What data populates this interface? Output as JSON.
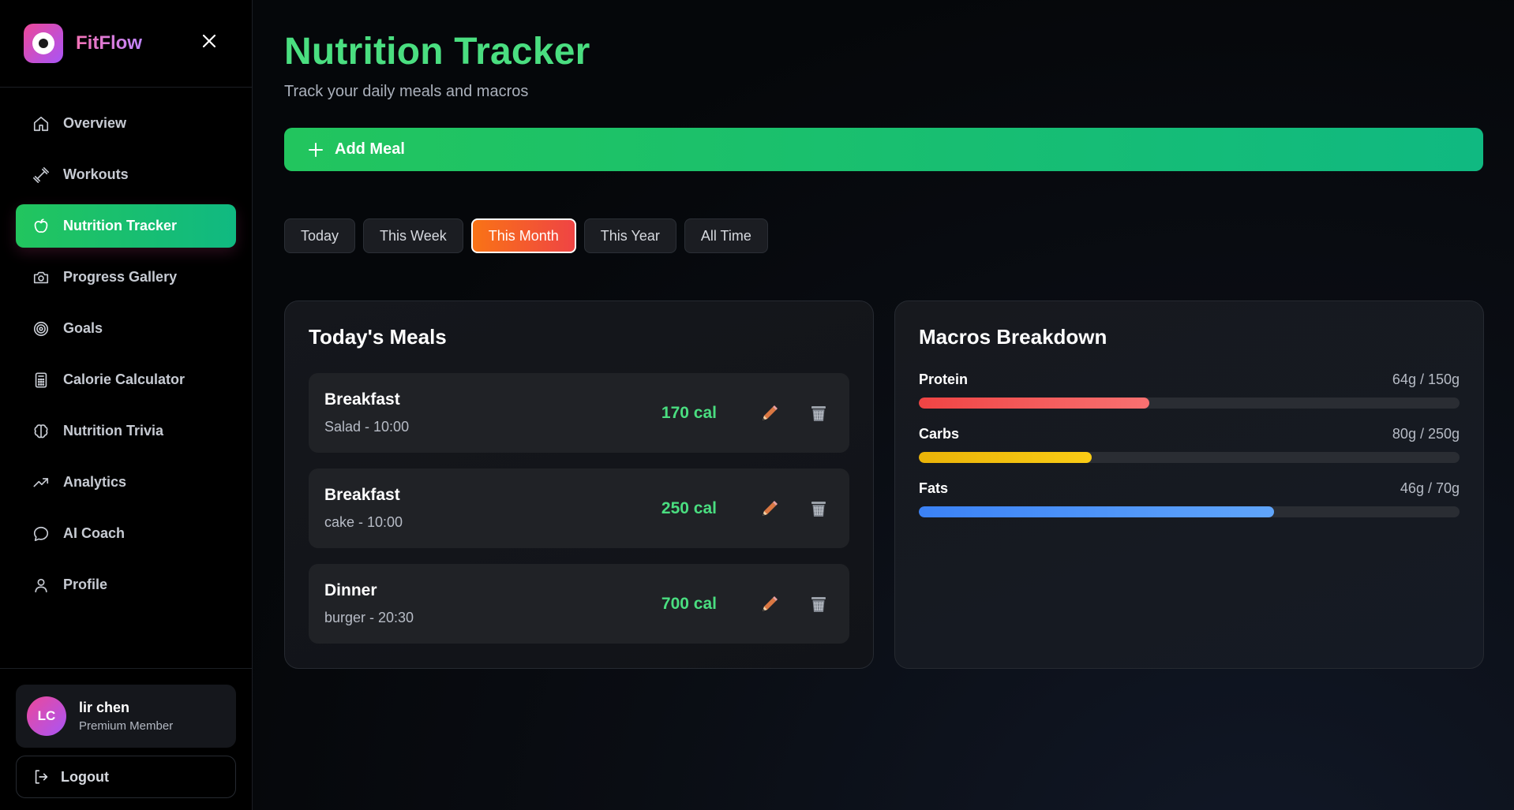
{
  "brand": {
    "name": "FitFlow"
  },
  "sidebar": {
    "items": [
      {
        "label": "Overview",
        "icon": "home-icon"
      },
      {
        "label": "Workouts",
        "icon": "dumbbell-icon"
      },
      {
        "label": "Nutrition Tracker",
        "icon": "apple-icon",
        "active": true
      },
      {
        "label": "Progress Gallery",
        "icon": "camera-icon"
      },
      {
        "label": "Goals",
        "icon": "target-icon"
      },
      {
        "label": "Calorie Calculator",
        "icon": "calculator-icon"
      },
      {
        "label": "Nutrition Trivia",
        "icon": "brain-icon"
      },
      {
        "label": "Analytics",
        "icon": "trending-up-icon"
      },
      {
        "label": "AI Coach",
        "icon": "chat-icon"
      },
      {
        "label": "Profile",
        "icon": "user-icon"
      }
    ]
  },
  "user": {
    "initials": "LC",
    "name": "lir chen",
    "role": "Premium Member"
  },
  "logout_label": "Logout",
  "header": {
    "title": "Nutrition Tracker",
    "subtitle": "Track your daily meals and macros"
  },
  "add_meal_label": "Add Meal",
  "filters": [
    "Today",
    "This Week",
    "This Month",
    "This Year",
    "All Time"
  ],
  "active_filter": "This Month",
  "meals_panel": {
    "title": "Today's Meals",
    "meals": [
      {
        "name": "Breakfast",
        "detail": "Salad - 10:00",
        "calories": "170 cal"
      },
      {
        "name": "Breakfast",
        "detail": "cake - 10:00",
        "calories": "250 cal"
      },
      {
        "name": "Dinner",
        "detail": "burger - 20:30",
        "calories": "700 cal"
      }
    ]
  },
  "macros_panel": {
    "title": "Macros Breakdown",
    "macros": [
      {
        "name": "Protein",
        "amount": "64g / 150g",
        "fraction": 0.4267,
        "color_from": "#ef4444",
        "color_to": "#f87171"
      },
      {
        "name": "Carbs",
        "amount": "80g / 250g",
        "fraction": 0.32,
        "color_from": "#eab308",
        "color_to": "#facc15"
      },
      {
        "name": "Fats",
        "amount": "46g / 70g",
        "fraction": 0.657,
        "color_from": "#3b82f6",
        "color_to": "#60a5fa"
      }
    ]
  },
  "colors": {
    "accent_green": "#22c55e",
    "accent_pink": "#ec4899",
    "active_filter_orange": "#f97316"
  }
}
